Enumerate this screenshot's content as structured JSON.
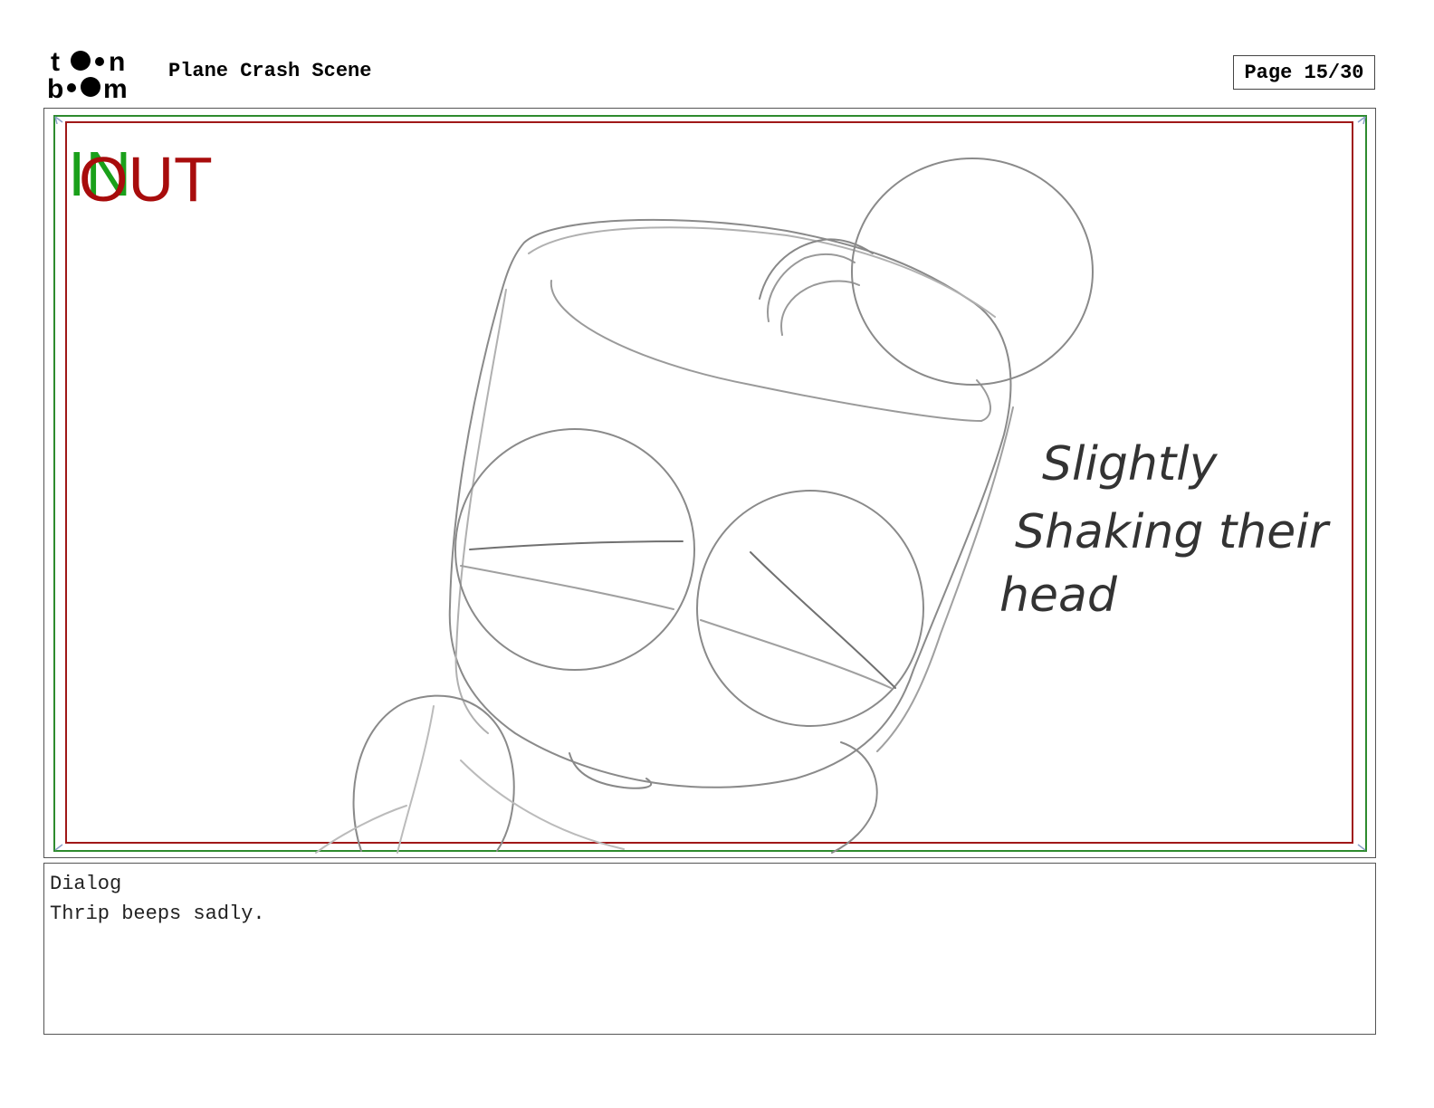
{
  "header": {
    "logo_line1": "toon",
    "logo_line2": "boom",
    "scene_title": "Plane Crash Scene",
    "page_label": "Page 15/30"
  },
  "panel": {
    "marker_in": "IN",
    "marker_out": "OUT",
    "note_line1": "Slightly",
    "note_line2": "Shaking their",
    "note_line3": "head",
    "colors": {
      "safe_frame": "#a01818",
      "action_frame": "#2e8b2e",
      "in_marker": "#1aa01a",
      "out_marker": "#a80c0c",
      "sketch": "#888888"
    }
  },
  "dialog": {
    "label": "Dialog",
    "text": "Thrip beeps sadly."
  }
}
